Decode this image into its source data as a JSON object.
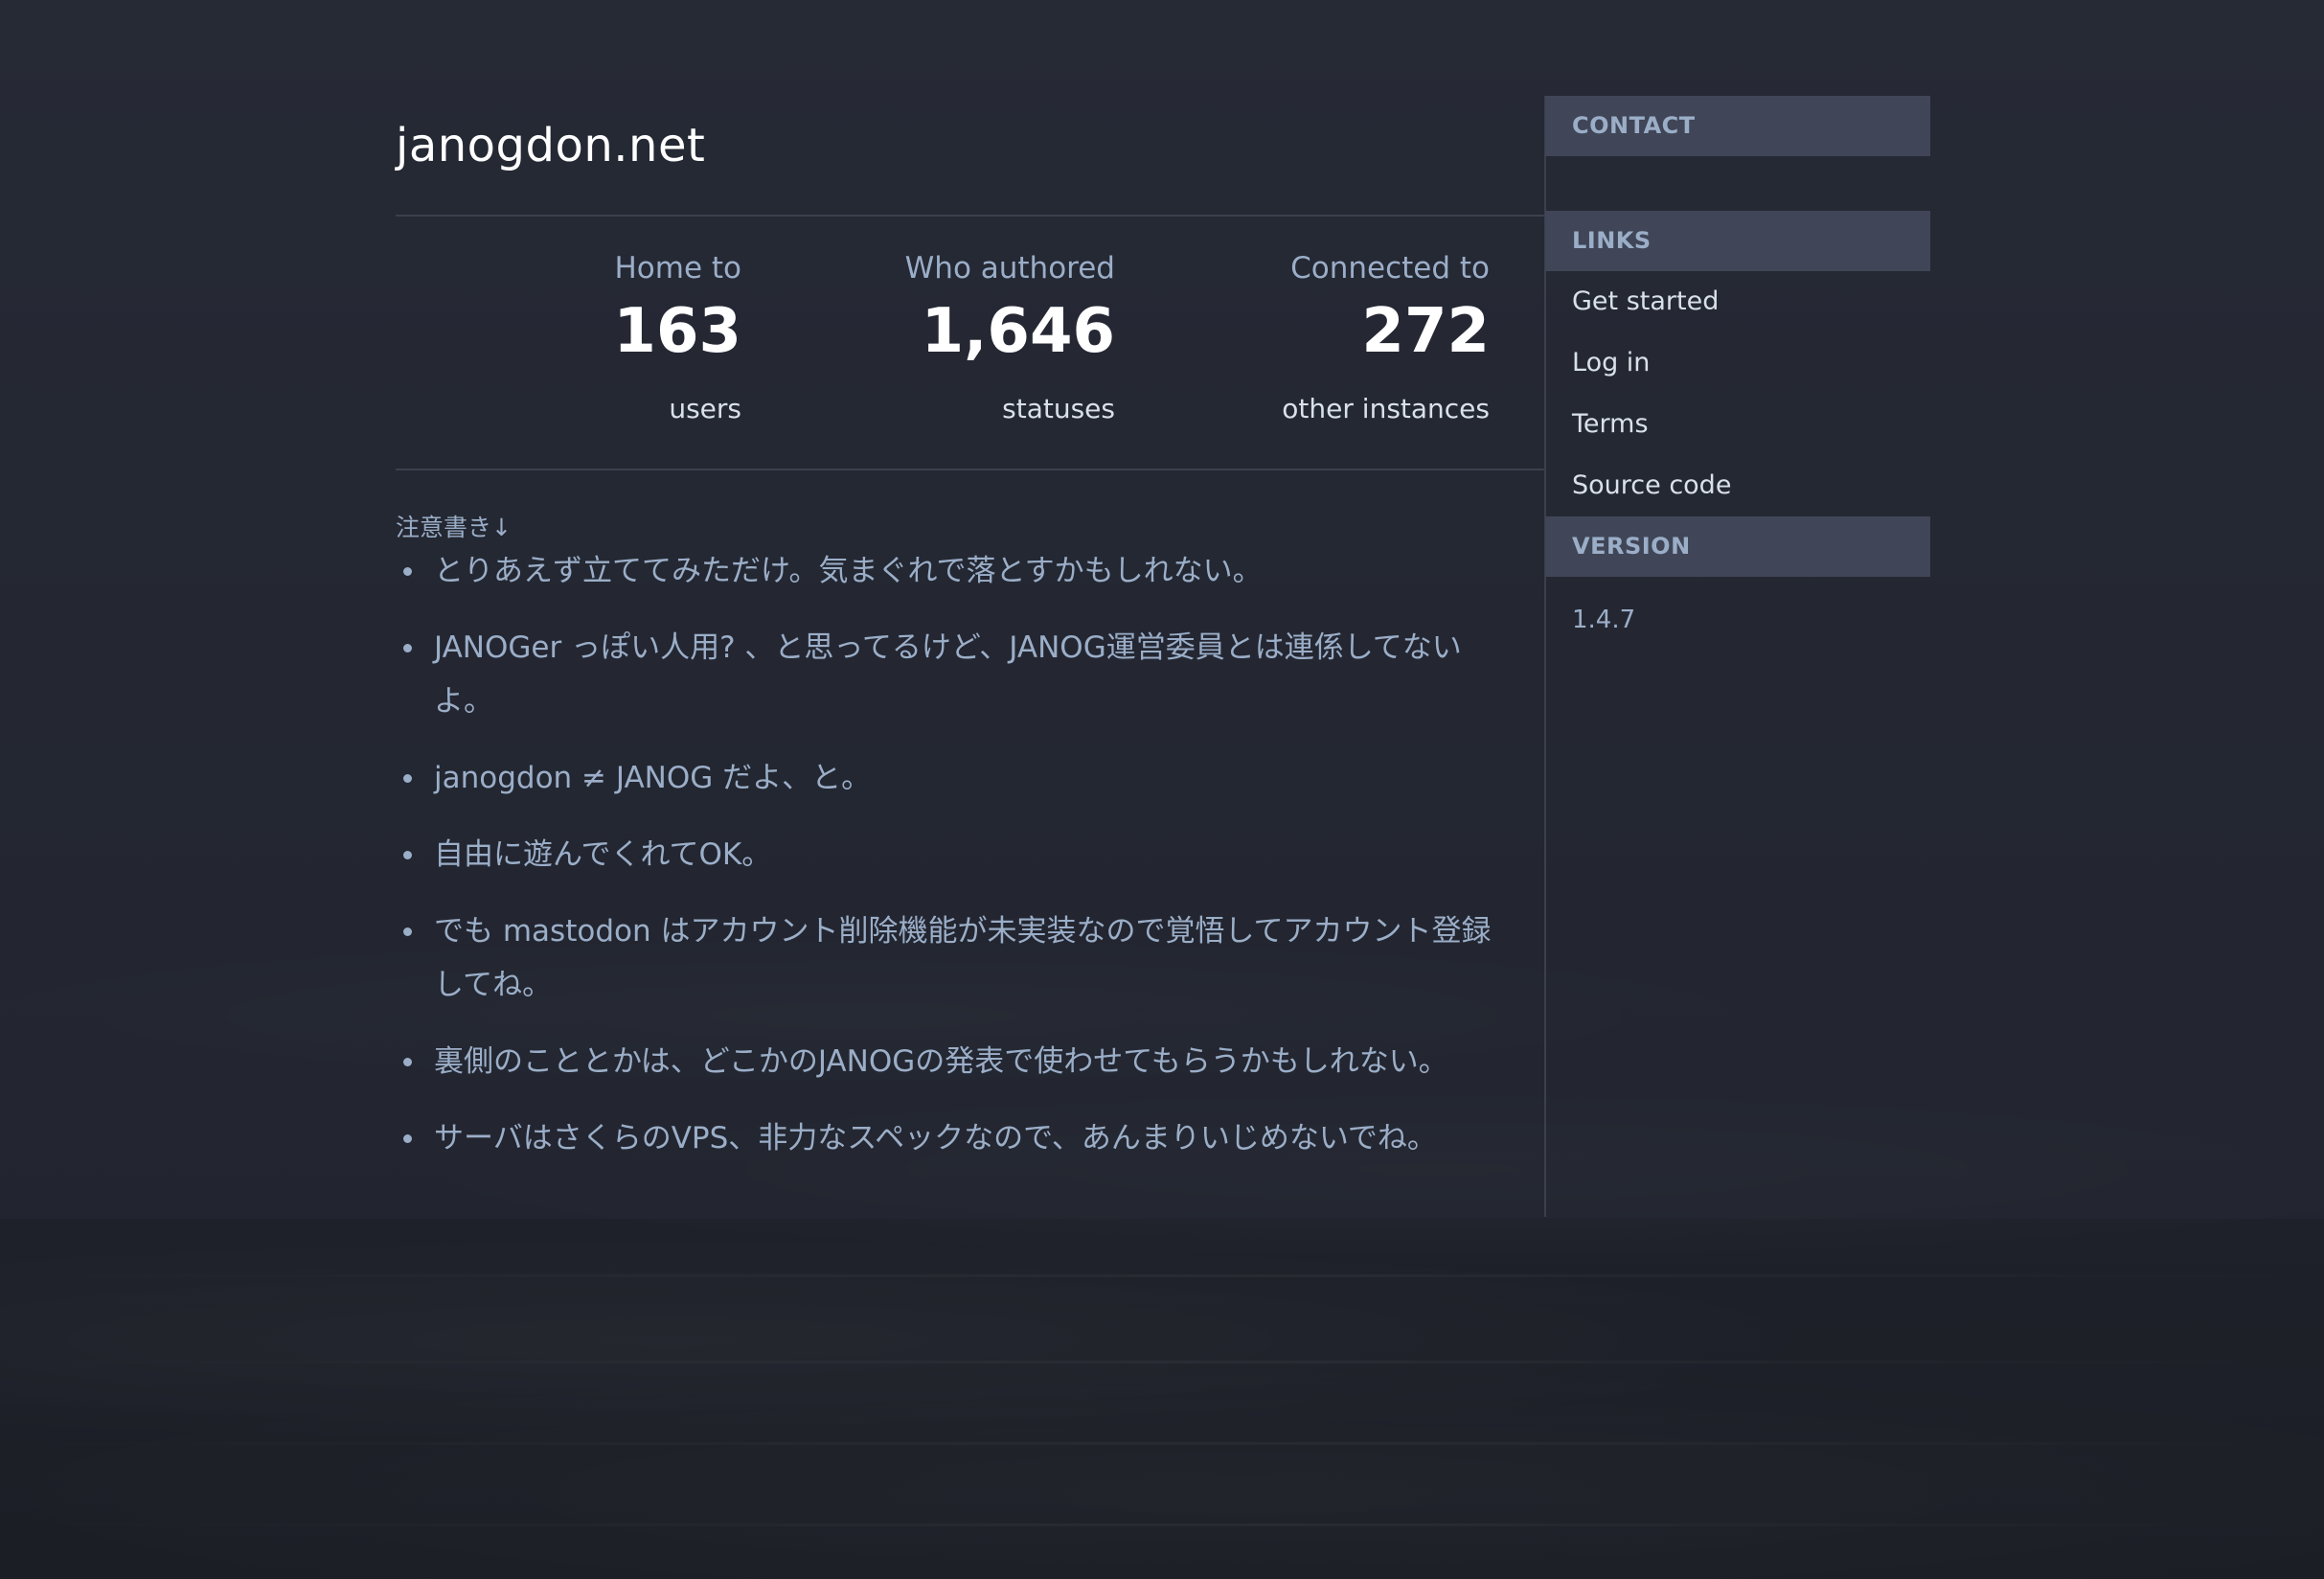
{
  "site": {
    "title": "janogdon.net"
  },
  "stats": [
    {
      "label": "Home to",
      "value": "163",
      "unit": "users"
    },
    {
      "label": "Who authored",
      "value": "1,646",
      "unit": "statuses"
    },
    {
      "label": "Connected to",
      "value": "272",
      "unit": "other instances"
    }
  ],
  "notice": {
    "heading": "注意書き↓",
    "items": [
      "とりあえず立ててみただけ。気まぐれで落とすかもしれない。",
      "JANOGer っぽい人用? 、と思ってるけど、JANOG運営委員とは連係してないよ。",
      "janogdon ≠ JANOG だよ、と。",
      "自由に遊んでくれてOK。",
      "でも mastodon はアカウント削除機能が未実装なので覚悟してアカウント登録してね。",
      "裏側のこととかは、どこかのJANOGの発表で使わせてもらうかもしれない。",
      "サーバはさくらのVPS、非力なスペックなので、あんまりいじめないでね。"
    ]
  },
  "sidebar": {
    "contact_header": "CONTACT",
    "links_header": "LINKS",
    "links": [
      "Get started",
      "Log in",
      "Terms",
      "Source code"
    ],
    "version_header": "VERSION",
    "version": "1.4.7"
  },
  "colors": {
    "background": "#22252f",
    "sidebar_header": "#404657",
    "text_primary": "#d9e1e8",
    "text_secondary": "#9baec8",
    "heading": "#ffffff"
  }
}
